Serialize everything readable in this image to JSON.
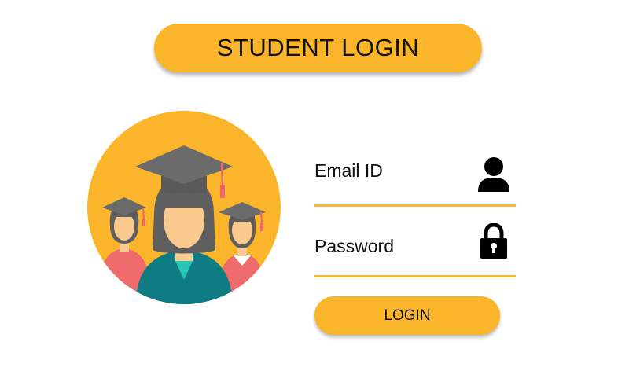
{
  "header": {
    "title": "STUDENT LOGIN"
  },
  "form": {
    "email_label": "Email ID",
    "email_icon": "user-icon",
    "password_label": "Password",
    "password_icon": "lock-icon",
    "login_button_label": "LOGIN"
  },
  "colors": {
    "accent": "#fbb52a",
    "underline": "#f5b63a",
    "gown_main": "#0f7b82",
    "gown_side": "#ef6b6b",
    "cap": "#6b6b6b",
    "hair": "#5f5f5f",
    "skin": "#f9c98e",
    "tassel": "#f0646b",
    "text": "#111111"
  },
  "illustration": {
    "name": "graduates-illustration"
  }
}
